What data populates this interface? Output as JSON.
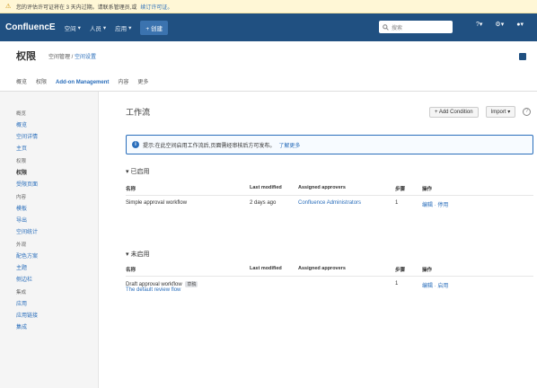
{
  "banner": {
    "text": "您的评估许可证将在 3 天内过期。请联系管理员,或",
    "link": "续订许可证。"
  },
  "topnav": {
    "logo": "ConfluencE",
    "items": [
      "空间",
      "人员",
      "应用"
    ],
    "create": "+ 创建",
    "search_placeholder": "搜索"
  },
  "header": {
    "title": "权限",
    "breadcrumb_prefix": "空间管理 /",
    "breadcrumb_link": "空间设置"
  },
  "tabs": [
    "概览",
    "权限",
    "Add-on Management",
    "内容",
    "更多"
  ],
  "sidebar": {
    "sections": [
      {
        "heading": "概览",
        "items": [
          "概览",
          "空间详情",
          "主页"
        ]
      },
      {
        "heading": "权限",
        "items": [
          "权限",
          "受限页面"
        ]
      },
      {
        "heading": "内容",
        "items": [
          "模板",
          "导出",
          "空间统计"
        ]
      },
      {
        "heading": "外观",
        "items": [
          "配色方案",
          "主题",
          "侧边栏"
        ]
      },
      {
        "heading": "集成",
        "items": [
          "应用",
          "应用链接",
          "集成"
        ]
      }
    ],
    "active": "权限"
  },
  "main": {
    "title": "工作流",
    "add_button": "+ Add Condition",
    "import_button": "Import ▾",
    "info_text": "提示:在此空间启用工作流后,页面需经审核后方可发布。",
    "info_link": "了解更多"
  },
  "section1": {
    "title": "已启用",
    "headers": [
      "名称",
      "Last modified",
      "Assigned approvers",
      "步骤",
      "操作"
    ],
    "rows": [
      {
        "name": "Simple approval workflow",
        "modified": "2 days ago",
        "approvers": "Confluence Administrators",
        "steps": "1",
        "actions": "编辑 · 停用"
      }
    ]
  },
  "section2": {
    "title": "未启用",
    "headers": [
      "名称",
      "Last modified",
      "Assigned approvers",
      "步骤",
      "操作"
    ],
    "rows": [
      {
        "name": "Draft approval workflow",
        "badge": "草稿",
        "desc": "The default review flow",
        "modified": "",
        "approvers": "",
        "steps": "1",
        "actions": "编辑 · 启用"
      }
    ]
  },
  "colors": {
    "nav": "#205081",
    "link": "#2a6ebb",
    "banner": "#fff7d6"
  }
}
